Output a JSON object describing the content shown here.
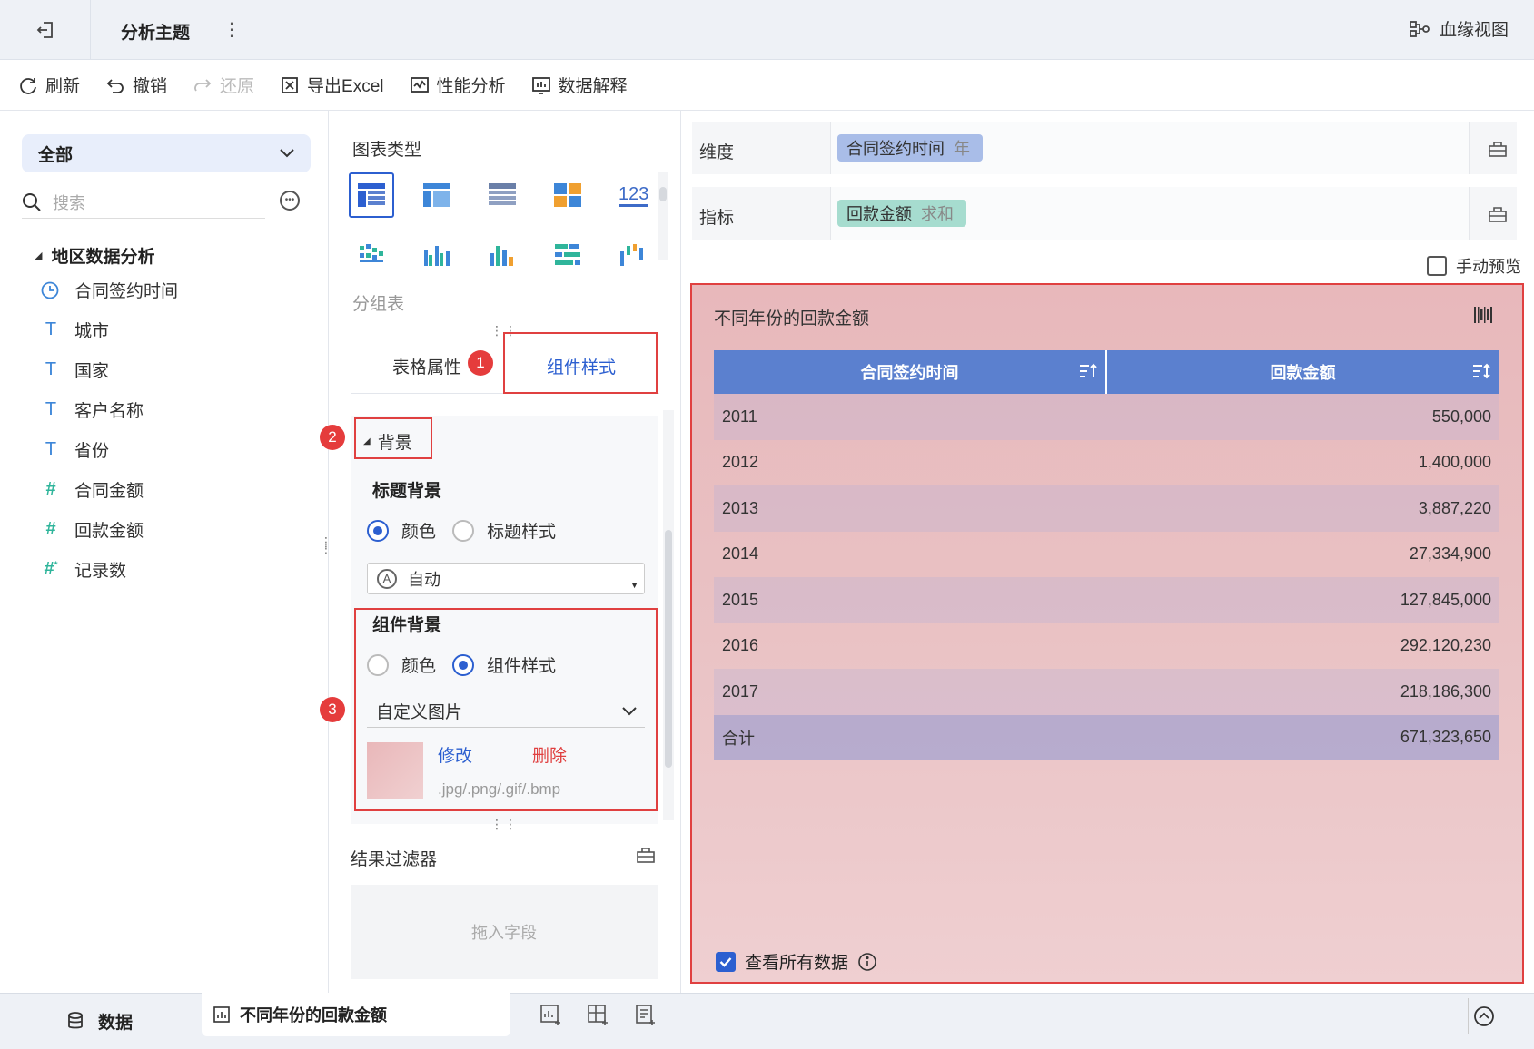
{
  "header": {
    "title": "分析主题",
    "lineage_label": "血缘视图"
  },
  "toolbar": {
    "refresh": "刷新",
    "undo": "撤销",
    "redo": "还原",
    "export_excel": "导出Excel",
    "performance": "性能分析",
    "data_explain": "数据解释"
  },
  "left": {
    "scope_select": "全部",
    "search_placeholder": "搜索",
    "group_title": "地区数据分析",
    "fields": [
      {
        "name": "合同签约时间",
        "icon": "clock-icon"
      },
      {
        "name": "城市",
        "icon": "text-icon"
      },
      {
        "name": "国家",
        "icon": "text-icon"
      },
      {
        "name": "客户名称",
        "icon": "text-icon"
      },
      {
        "name": "省份",
        "icon": "text-icon"
      },
      {
        "name": "合同金额",
        "icon": "number-icon"
      },
      {
        "name": "回款金额",
        "icon": "number-icon"
      },
      {
        "name": "记录数",
        "icon": "count-icon"
      }
    ]
  },
  "middle": {
    "chart_type_label": "图表类型",
    "selected_type": "分组表",
    "tabs": [
      "表格属性",
      "组件样式"
    ],
    "badges": [
      "1",
      "2",
      "3"
    ],
    "background_section": "背景",
    "title_bg_label": "标题背景",
    "title_bg_options": [
      "颜色",
      "标题样式"
    ],
    "title_bg_value": "自动",
    "component_bg_label": "组件背景",
    "component_bg_options": [
      "颜色",
      "组件样式"
    ],
    "component_style_value": "自定义图片",
    "modify": "修改",
    "delete": "删除",
    "file_hint": ".jpg/.png/.gif/.bmp",
    "filter_label": "结果过滤器",
    "drop_hint": "拖入字段"
  },
  "right": {
    "dimension_label": "维度",
    "dimension_field": "合同签约时间",
    "dimension_sub": "年",
    "measure_label": "指标",
    "measure_field": "回款金额",
    "measure_sub": "求和",
    "manual_preview": "手动预览",
    "preview_title": "不同年份的回款金额",
    "columns": [
      "合同签约时间",
      "回款金额"
    ],
    "rows": [
      [
        "2011",
        "550,000"
      ],
      [
        "2012",
        "1,400,000"
      ],
      [
        "2013",
        "3,887,220"
      ],
      [
        "2014",
        "27,334,900"
      ],
      [
        "2015",
        "127,845,000"
      ],
      [
        "2016",
        "292,120,230"
      ],
      [
        "2017",
        "218,186,300"
      ]
    ],
    "total": [
      "合计",
      "671,323,650"
    ],
    "view_all": "查看所有数据"
  },
  "bottom": {
    "data_tab": "数据",
    "sheet_tab": "不同年份的回款金额"
  },
  "colors": {
    "accent": "#2c5fd0",
    "header_blue": "#5b80cf",
    "annotation_red": "#e04040",
    "dim_pill": "#a9bde8",
    "measure_pill": "#a6dccf"
  }
}
